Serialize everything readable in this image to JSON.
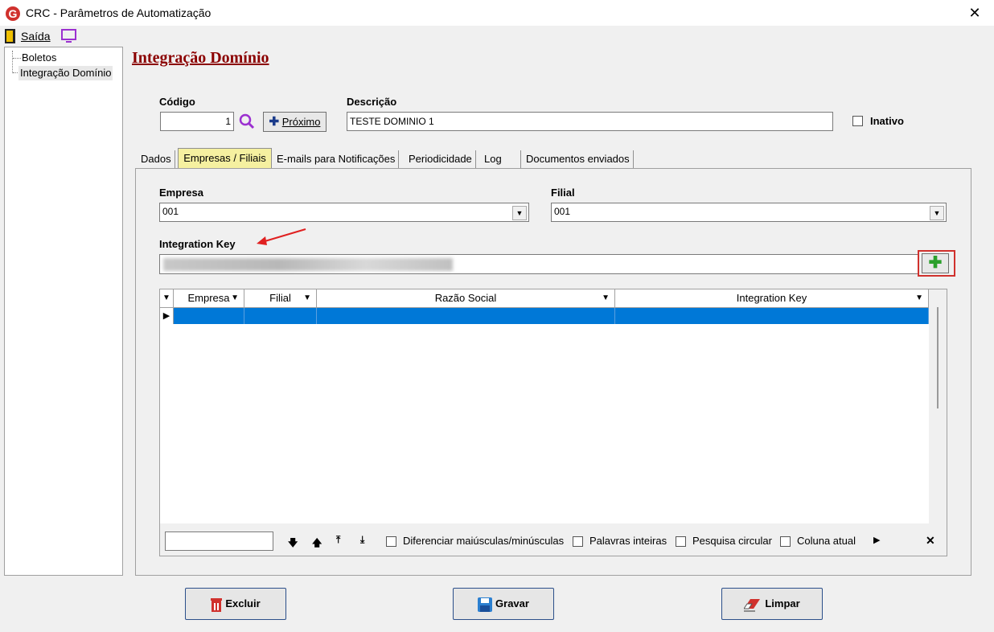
{
  "window": {
    "title": "CRC - Parâmetros de Automatização"
  },
  "menu": {
    "exit_label": "Saída"
  },
  "tree": {
    "items": [
      {
        "label": "Boletos"
      },
      {
        "label": "Integração Domínio"
      }
    ]
  },
  "page": {
    "heading": "Integração Domínio"
  },
  "form": {
    "code_label": "Código",
    "code_value": "1",
    "next_label": "Próximo",
    "description_label": "Descrição",
    "description_value": "TESTE DOMINIO 1",
    "inactive_label": "Inativo"
  },
  "tabs": [
    {
      "label": "Dados"
    },
    {
      "label": "Empresas / Filiais"
    },
    {
      "label": "E-mails para Notificações"
    },
    {
      "label": "Periodicidade"
    },
    {
      "label": "Log"
    },
    {
      "label": "Documentos enviados"
    }
  ],
  "companies": {
    "company_label": "Empresa",
    "company_value": "001",
    "branch_label": "Filial",
    "branch_value": "001",
    "integration_key_label": "Integration Key"
  },
  "grid": {
    "columns": [
      {
        "label": "Empresa"
      },
      {
        "label": "Filial"
      },
      {
        "label": "Razão Social"
      },
      {
        "label": "Integration Key"
      }
    ]
  },
  "search": {
    "case_label": "Diferenciar maiúsculas/minúsculas",
    "whole_words_label": "Palavras inteiras",
    "circular_label": "Pesquisa circular",
    "current_column_label": "Coluna atual"
  },
  "actions": {
    "delete_label": "Excluir",
    "save_label": "Gravar",
    "clear_label": "Limpar"
  },
  "colors": {
    "heading": "#8b0000",
    "selection": "#0078d7",
    "active_tab": "#f5f0a0",
    "highlight": "#d0312d"
  }
}
